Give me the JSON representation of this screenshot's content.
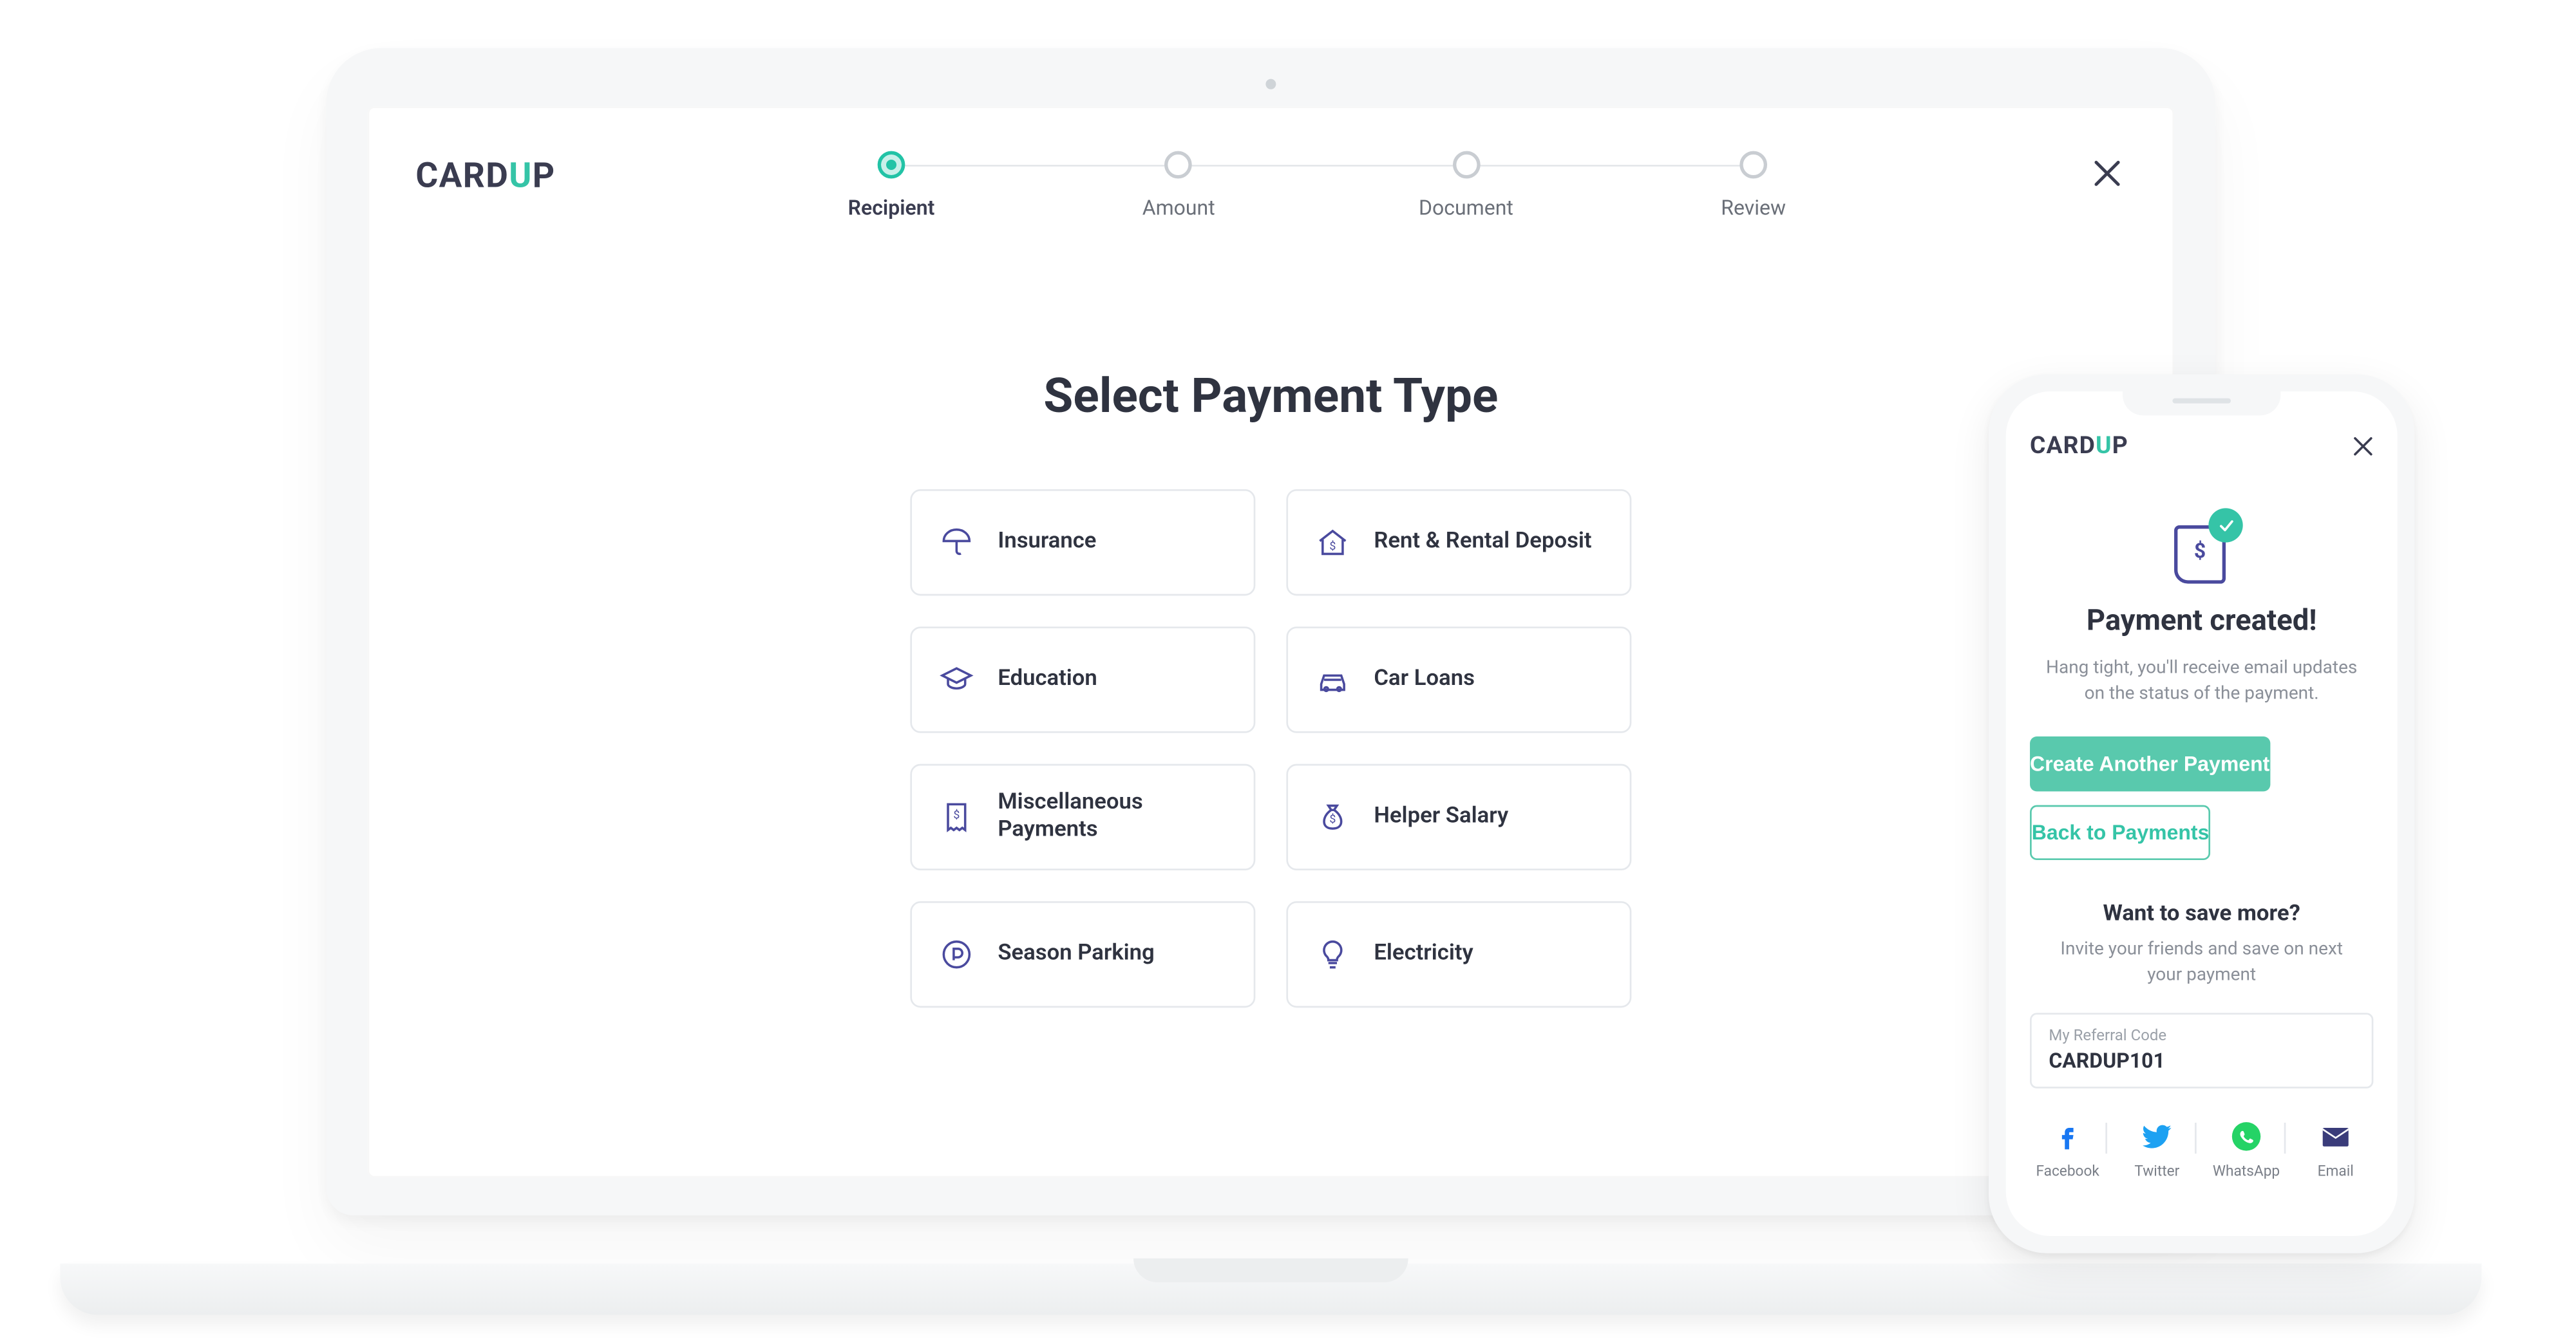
{
  "brand": {
    "prefix": "CARD",
    "accent": "U",
    "suffix": "P"
  },
  "desktop": {
    "stepper": {
      "steps": [
        {
          "label": "Recipient",
          "active": true
        },
        {
          "label": "Amount",
          "active": false
        },
        {
          "label": "Document",
          "active": false
        },
        {
          "label": "Review",
          "active": false
        }
      ]
    },
    "title": "Select Payment Type",
    "options": [
      {
        "key": "insurance",
        "label": "Insurance",
        "icon": "umbrella-icon"
      },
      {
        "key": "rent",
        "label": "Rent & Rental Deposit",
        "icon": "home-dollar-icon"
      },
      {
        "key": "education",
        "label": "Education",
        "icon": "graduation-cap-icon"
      },
      {
        "key": "carloans",
        "label": "Car Loans",
        "icon": "car-icon"
      },
      {
        "key": "misc",
        "label": "Miscellaneous Payments",
        "icon": "receipt-icon"
      },
      {
        "key": "helper",
        "label": "Helper Salary",
        "icon": "money-bag-icon"
      },
      {
        "key": "parking",
        "label": "Season Parking",
        "icon": "parking-icon"
      },
      {
        "key": "elec",
        "label": "Electricity",
        "icon": "bulb-icon"
      }
    ]
  },
  "mobile": {
    "title": "Payment created!",
    "subtitle": "Hang tight, you'll receive email updates on the status of the payment.",
    "primary_btn": "Create Another Payment",
    "secondary_btn": "Back to Payments",
    "save_more_title": "Want to save more?",
    "save_more_sub": "Invite your friends and save on next your payment",
    "referral_label": "My Referral Code",
    "referral_code": "CARDUP101",
    "share": [
      {
        "label": "Facebook",
        "icon": "facebook-icon",
        "color": "#1877F2"
      },
      {
        "label": "Twitter",
        "icon": "twitter-icon",
        "color": "#1DA1F2"
      },
      {
        "label": "WhatsApp",
        "icon": "whatsapp-icon",
        "color": "#25D366"
      },
      {
        "label": "Email",
        "icon": "mail-icon",
        "color": "#3a3c7a"
      }
    ]
  },
  "colors": {
    "accent": "#35c4a7",
    "brand": "#3a3c50",
    "icon": "#4a4a9e"
  }
}
